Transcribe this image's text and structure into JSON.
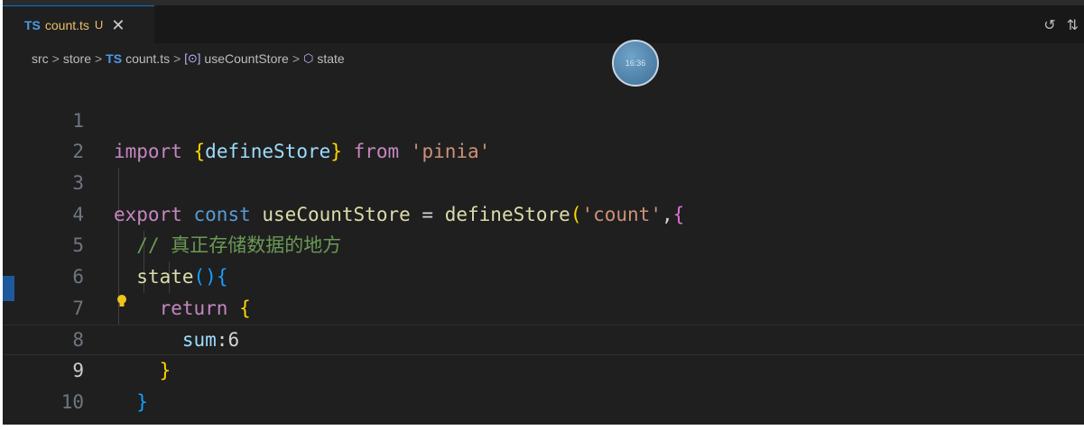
{
  "tab": {
    "lang": "TS",
    "filename": "count.ts",
    "status": "U",
    "close": "✕"
  },
  "toolbar": {
    "history_icon": "↺",
    "compare_icon": "⇅"
  },
  "breadcrumbs": {
    "items": [
      {
        "label": "src"
      },
      {
        "label": "store"
      },
      {
        "lang": "TS",
        "label": "count.ts"
      },
      {
        "icon": "[⊙]",
        "label": "useCountStore"
      },
      {
        "icon": "⬡",
        "label": "state"
      }
    ],
    "separator": ">"
  },
  "clock": {
    "time": "16:36"
  },
  "editor": {
    "current_line": 9,
    "line_numbers": [
      "1",
      "2",
      "3",
      "4",
      "5",
      "6",
      "7",
      "8",
      "9",
      "10"
    ]
  },
  "colors": {
    "accent": "#0078d4",
    "background": "#1f1f1f",
    "keyword": "#569cd6",
    "string": "#ce9178",
    "comment": "#6a9955"
  }
}
